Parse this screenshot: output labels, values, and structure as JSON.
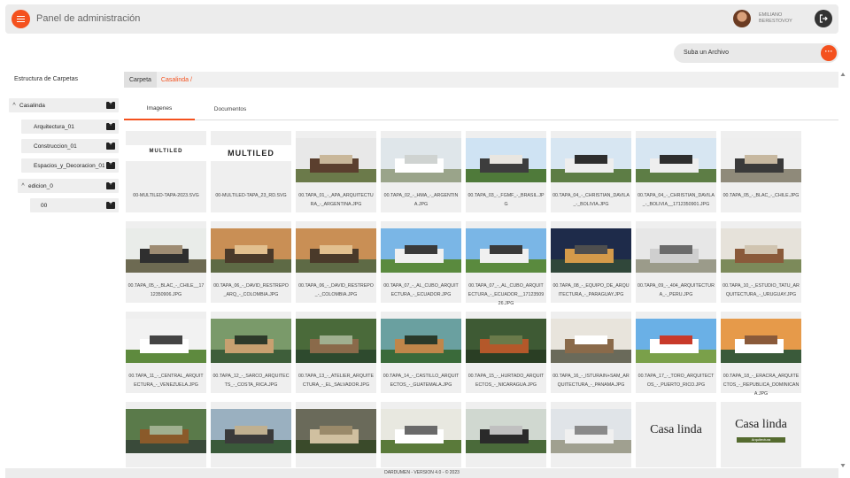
{
  "header": {
    "title": "Panel de administración",
    "user_name": "EMILIANO BERESTOVOY",
    "menu_icon": "hamburger-icon",
    "logout_icon": "logout-icon"
  },
  "upload": {
    "label": "Suba un Archivo",
    "button": "···"
  },
  "sidebar": {
    "title": "Estructura de Carpetas",
    "items": [
      {
        "label": "Casalinda",
        "expanded": true
      },
      {
        "label": "Arquitectura_01"
      },
      {
        "label": "Construccion_01"
      },
      {
        "label": "Espacios_y_Decoracion_01"
      },
      {
        "label": "edicion_0",
        "expanded": true
      },
      {
        "label": "00"
      }
    ]
  },
  "breadcrumb": {
    "root": "Carpeta",
    "path": "Casalinda /"
  },
  "tabs": [
    {
      "label": "Imagenes",
      "active": true
    },
    {
      "label": "Documentos",
      "active": false
    }
  ],
  "files": [
    {
      "name": "00-MULTILED-TAPA-2023.SVG",
      "kind": "logo",
      "logo_text": "MULTILED"
    },
    {
      "name": "00-MULTILED-TAPA_23_RD.SVG",
      "kind": "logo-dark",
      "logo_text": "MULTILED"
    },
    {
      "name": "00.TAPA_01_-_APA_ARQUITECTURA_-_ARGENTINA.JPG",
      "kind": "photo"
    },
    {
      "name": "00.TAPA_02_-_HMA_-_ARGENTINA.JPG",
      "kind": "photo"
    },
    {
      "name": "00.TAPA_03_-_FGMF_-_BRASIL.JPG",
      "kind": "photo"
    },
    {
      "name": "00.TAPA_04_-_CHRISTIAN_DAVILA_-_BOLIVIA.JPG",
      "kind": "photo"
    },
    {
      "name": "00.TAPA_04_-_CHRISTIAN_DAVILA_-_BOLIVIA__1712350901.JPG",
      "kind": "photo"
    },
    {
      "name": "00.TAPA_05_-_BLAC_-_CHILE.JPG",
      "kind": "photo"
    },
    {
      "name": "00.TAPA_05_-_BLAC_-_CHILE__1712350906.JPG",
      "kind": "photo"
    },
    {
      "name": "00.TAPA_06_-_DAVID_RESTREPO_ARQ_-_COLOMBIA.JPG",
      "kind": "photo"
    },
    {
      "name": "00.TAPA_06_-_DAVID_RESTREPO_-_COLOMBIA.JPG",
      "kind": "photo"
    },
    {
      "name": "00.TAPA_07_-_AL_CUBO_ARQUITECTURA_-_ECUADOR.JPG",
      "kind": "photo"
    },
    {
      "name": "00.TAPA_07_-_AL_CUBO_ARQUITECTURA_-_ECUADOR__1712350926.JPG",
      "kind": "photo"
    },
    {
      "name": "00.TAPA_08_-_EQUIPO_DE_ARQUITECTURA_-_PARAGUAY.JPG",
      "kind": "photo"
    },
    {
      "name": "00.TAPA_09_-_404_ARQUITECTURA_-_PERU.JPG",
      "kind": "photo"
    },
    {
      "name": "00.TAPA_10_-_ESTUDIO_TATU_ARQUITECTURA_-_URUGUAY.JPG",
      "kind": "photo"
    },
    {
      "name": "00.TAPA_11_-_CENTRAL_ARQUITECTURA_-_VENEZUELA.JPG",
      "kind": "photo"
    },
    {
      "name": "00.TAPA_12_-_SARCO_ARQUITECTS_-_COSTA_RICA.JPG",
      "kind": "photo"
    },
    {
      "name": "00.TAPA_13_-_ATELIER_ARQUITECTURA_-_EL_SALVADOR.JPG",
      "kind": "photo"
    },
    {
      "name": "00.TAPA_14_-_CASTILLO_ARQUITECTOS_-_GUATEMALA.JPG",
      "kind": "photo"
    },
    {
      "name": "00.TAPA_15_-_HURTADO_ARQUITECTOS_-_NICARAGUA.JPG",
      "kind": "photo"
    },
    {
      "name": "00.TAPA_16_-_ISTURAIN+SAM_ARQUITECTURA_-_PANAMA.JPG",
      "kind": "photo"
    },
    {
      "name": "00.TAPA_17_-_TORO_ARQUITECTOS_-_PUERTO_RICO.JPG",
      "kind": "photo"
    },
    {
      "name": "00.TAPA_18_-_ERACRA_ARQUITECTOS_-_REPUBLICA_DOMINICANA.JPG",
      "kind": "photo"
    },
    {
      "name": "",
      "kind": "photo"
    },
    {
      "name": "",
      "kind": "photo"
    },
    {
      "name": "",
      "kind": "photo"
    },
    {
      "name": "",
      "kind": "photo"
    },
    {
      "name": "",
      "kind": "photo"
    },
    {
      "name": "",
      "kind": "photo"
    },
    {
      "name": "",
      "kind": "casalinda",
      "logo_text": "Casa linda"
    },
    {
      "name": "",
      "kind": "casalinda-green",
      "logo_text": "Casa linda",
      "sub_text": "Arquitectura"
    }
  ],
  "palettes": [
    [
      "#e8e8e8",
      "#6b7a4a",
      "#5b3f2e",
      "#c9b79a"
    ],
    [
      "#dfe6ea",
      "#9aa48a",
      "#ffffff",
      "#cfd3d1"
    ],
    [
      "#cfe3f3",
      "#4f7a3a",
      "#3d3d3d",
      "#e9e6e0"
    ],
    [
      "#d7e6f2",
      "#5d7d45",
      "#eeeeee",
      "#2e2e2e"
    ],
    [
      "#d7e6f2",
      "#5d7d45",
      "#eeeeee",
      "#2e2e2e"
    ],
    [
      "#eeeeee",
      "#8f8a7a",
      "#3a3a3a",
      "#c7b8a0"
    ],
    [
      "#e9ece9",
      "#6d6a52",
      "#2f2f2f",
      "#9e8c73"
    ],
    [
      "#c98f55",
      "#5e6a45",
      "#4a3a2a",
      "#e2c08f"
    ],
    [
      "#c98f55",
      "#5e6a45",
      "#4a3a2a",
      "#e2c08f"
    ],
    [
      "#7ab6e6",
      "#5a8a3e",
      "#f0f0f0",
      "#3a3a3a"
    ],
    [
      "#7ab6e6",
      "#5a8a3e",
      "#f0f0f0",
      "#3a3a3a"
    ],
    [
      "#1e2b4a",
      "#30473a",
      "#d49a4a",
      "#4e4e4e"
    ],
    [
      "#e7e7e7",
      "#9b9b8a",
      "#cfcfcf",
      "#6b6b6b"
    ],
    [
      "#e6e2da",
      "#7c8a5a",
      "#8a5a3a",
      "#d0c4b0"
    ],
    [
      "#f2f2f2",
      "#5e8a3e",
      "#ffffff",
      "#444444"
    ],
    [
      "#7a9a6a",
      "#3e5e3a",
      "#c8a070",
      "#2e3a2a"
    ],
    [
      "#4a6a3a",
      "#2e4a2e",
      "#8a6a4a",
      "#a0b090"
    ],
    [
      "#6aa0a0",
      "#3a6a3a",
      "#c0864a",
      "#2a3a2a"
    ],
    [
      "#3e5a34",
      "#2a3e24",
      "#b4582a",
      "#6a7a4a"
    ],
    [
      "#e8e4dc",
      "#6a6a5a",
      "#8a6a4a",
      "#ffffff"
    ],
    [
      "#6ab0e6",
      "#7aa04a",
      "#ffffff",
      "#c83a2a"
    ],
    [
      "#e69a4a",
      "#3a5a3a",
      "#ffffff",
      "#8a5a3a"
    ],
    [
      "#5a7a4a",
      "#3a4a3a",
      "#8a5a2a",
      "#a0b090"
    ],
    [
      "#9ab0c0",
      "#3a5a3a",
      "#3a3a3a",
      "#c0b090"
    ],
    [
      "#6a6a5a",
      "#3a4a2a",
      "#d0c0a0",
      "#9a8a6a"
    ],
    [
      "#e8e8e0",
      "#5a7a3a",
      "#ffffff",
      "#6a6a6a"
    ],
    [
      "#d0d8d0",
      "#4a6a3a",
      "#2a2a2a",
      "#c0c0c0"
    ],
    [
      "#e0e4e8",
      "#a0a090",
      "#f0f0f0",
      "#8a8a8a"
    ],
    [
      "#ffffff",
      "#ffffff",
      "#ffffff",
      "#ffffff"
    ],
    [
      "#ffffff",
      "#ffffff",
      "#ffffff",
      "#ffffff"
    ]
  ],
  "footer": {
    "text": "DARDUMEN - VERSION 4.0 - © 2023"
  },
  "colors": {
    "accent": "#f4511e",
    "dark": "#333333"
  }
}
